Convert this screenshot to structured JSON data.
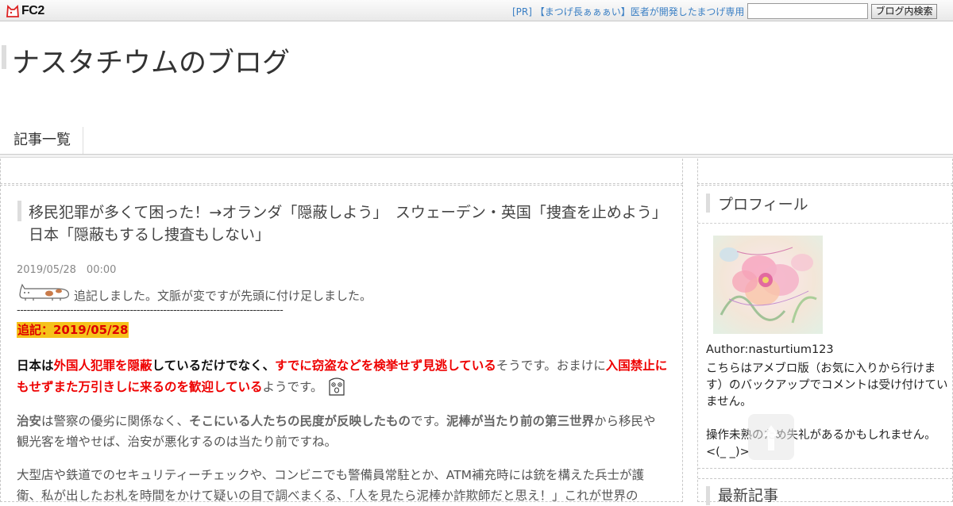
{
  "topbar": {
    "logo_text": "FC2",
    "pr_link": "[PR] 【まつげ長ぁぁぁい】医者が開発したまつげ専用",
    "search_placeholder": "",
    "search_button": "ブログ内検索"
  },
  "blog": {
    "title": "ナスタチウムのブログ"
  },
  "nav": {
    "items": [
      {
        "label": "記事一覧"
      }
    ]
  },
  "article": {
    "title": "移民犯罪が多くて困った！→オランダ「隠蔽しよう」　スウェーデン・英国「捜査を止めよう」　日本「隠蔽もするし捜査もしない」",
    "date": "2019/05/28　00:00",
    "note": "追記しました。文脈が変ですが先頭に付け足しました。",
    "divider": "--------------------------------------------------------------------------------",
    "added_label": "追記：2019/05/28",
    "p1": {
      "s1": "日本は",
      "s2": "外国人犯罪を隠蔽",
      "s3": "しているだけでなく、",
      "s4": "すでに窃盗などを検挙せず見逃している",
      "s5": "そうです。おまけに",
      "s6": "入国禁止にもせずまた万引きしに来るのを歓迎している",
      "s7": "ようです。"
    },
    "p2": {
      "s1": "治安",
      "s2": "は警察の優劣に関係なく、",
      "s3": "そこにいる人たちの民度が反映したもの",
      "s4": "です。",
      "s5": "泥棒が当たり前の第三世界",
      "s6": "から移民や観光客を増やせば、治安が悪化するのは当たり前ですね。"
    },
    "p3": "大型店や鉄道でのセキュリティーチェックや、コンビニでも警備員常駐とか、ATM補充時には銃を構えた兵士が護衛、私が出したお札を時間をかけて疑いの目で調べまくる、「人を見たら泥棒か詐欺師だと思え！」これが世界の"
  },
  "sidebar": {
    "profile_heading": "プロフィール",
    "author": "Author:nasturtium123",
    "text1": "こちらはアメブロ版（お気に入りから行けます）のバックアップでコメントは受け付けていません。",
    "text2": "操作未熟のため失礼があるかもしれません。<(_ _)>",
    "recent_heading": "最新記事"
  },
  "colors": {
    "accent_red": "#e00000",
    "highlight_yellow": "#f5c21b",
    "link_blue": "#3a7fc4"
  }
}
